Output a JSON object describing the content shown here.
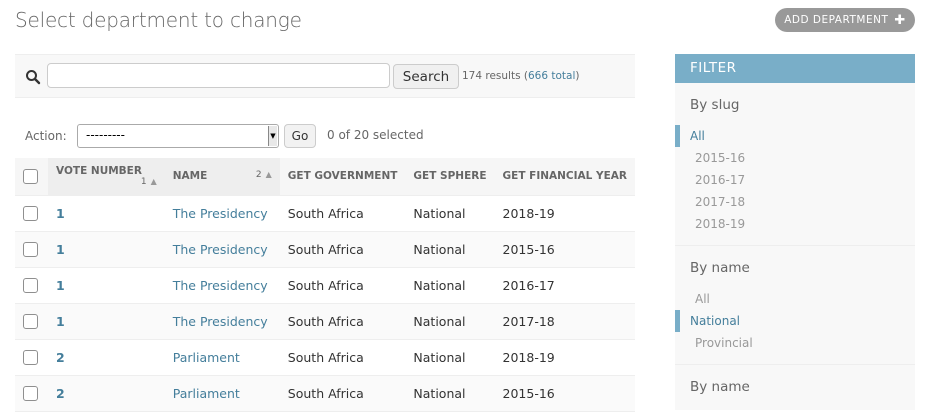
{
  "page": {
    "title": "Select department to change",
    "add_button_label": "ADD DEPARTMENT"
  },
  "toolbar": {
    "search_value": "",
    "search_button": "Search",
    "results_prefix": "174 results (",
    "total_link": "666 total",
    "results_suffix": ")"
  },
  "actions": {
    "label": "Action:",
    "selected_option": "---------",
    "go_label": "Go",
    "selected_count": "0 of 20 selected"
  },
  "table": {
    "columns": [
      {
        "label": "VOTE NUMBER",
        "sort_index": "1"
      },
      {
        "label": "NAME",
        "sort_index": "2"
      },
      {
        "label": "GET GOVERNMENT"
      },
      {
        "label": "GET SPHERE"
      },
      {
        "label": "GET FINANCIAL YEAR"
      }
    ],
    "rows": [
      {
        "vote": "1",
        "name": "The Presidency",
        "government": "South Africa",
        "sphere": "National",
        "year": "2018-19"
      },
      {
        "vote": "1",
        "name": "The Presidency",
        "government": "South Africa",
        "sphere": "National",
        "year": "2015-16"
      },
      {
        "vote": "1",
        "name": "The Presidency",
        "government": "South Africa",
        "sphere": "National",
        "year": "2016-17"
      },
      {
        "vote": "1",
        "name": "The Presidency",
        "government": "South Africa",
        "sphere": "National",
        "year": "2017-18"
      },
      {
        "vote": "2",
        "name": "Parliament",
        "government": "South Africa",
        "sphere": "National",
        "year": "2018-19"
      },
      {
        "vote": "2",
        "name": "Parliament",
        "government": "South Africa",
        "sphere": "National",
        "year": "2015-16"
      }
    ]
  },
  "filter": {
    "title": "FILTER",
    "groups": [
      {
        "heading": "By slug",
        "options": [
          "All",
          "2015-16",
          "2016-17",
          "2017-18",
          "2018-19"
        ],
        "selected": "All"
      },
      {
        "heading": "By name",
        "options": [
          "All",
          "National",
          "Provincial"
        ],
        "selected": "National"
      },
      {
        "heading": "By name",
        "options": []
      }
    ]
  },
  "colors": {
    "link": "#447e9b",
    "filter_header": "#79aec8",
    "add_button": "#999999"
  }
}
